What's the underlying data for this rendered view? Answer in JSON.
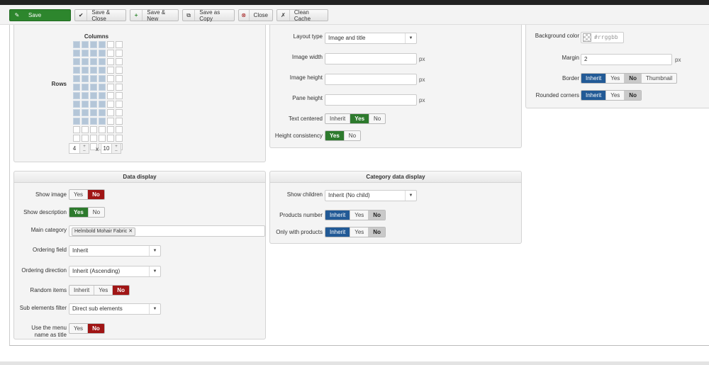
{
  "toolbar": {
    "save": "Save",
    "save_close": "Save & Close",
    "save_new": "Save & New",
    "save_copy": "Save as Copy",
    "close": "Close",
    "clean_cache": "Clean Cache"
  },
  "layout_grid": {
    "columns_label": "Columns",
    "rows_label": "Rows",
    "columns_value": "4",
    "times": "x",
    "rows_value": "10"
  },
  "layout_settings": {
    "layout_type_label": "Layout type",
    "layout_type_value": "Image and title",
    "image_width_label": "Image width",
    "image_width_value": "",
    "image_height_label": "Image height",
    "image_height_value": "",
    "pane_height_label": "Pane height",
    "pane_height_value": "",
    "px": "px",
    "text_centered_label": "Text centered",
    "text_centered_options": [
      "Inherit",
      "Yes",
      "No"
    ],
    "height_consistency_label": "Height consistency",
    "height_consistency_options": [
      "Yes",
      "No"
    ]
  },
  "style_settings": {
    "background_color_label": "Background color",
    "background_color_placeholder": "#rrggbb",
    "margin_label": "Margin",
    "margin_value": "2",
    "px": "px",
    "border_label": "Border",
    "border_options": [
      "Inherit",
      "Yes",
      "No",
      "Thumbnail"
    ],
    "rounded_corners_label": "Rounded corners",
    "rounded_corners_options": [
      "Inherit",
      "Yes",
      "No"
    ]
  },
  "data_display": {
    "title": "Data display",
    "show_image_label": "Show image",
    "show_image_options": [
      "Yes",
      "No"
    ],
    "show_description_label": "Show description",
    "show_description_options": [
      "Yes",
      "No"
    ],
    "main_category_label": "Main category",
    "main_category_tag": "Helmbold Mohair Fabric",
    "ordering_field_label": "Ordering field",
    "ordering_field_value": "Inherit",
    "ordering_direction_label": "Ordering direction",
    "ordering_direction_value": "Inherit (Ascending)",
    "random_items_label": "Random items",
    "random_items_options": [
      "Inherit",
      "Yes",
      "No"
    ],
    "sub_elements_filter_label": "Sub elements filter",
    "sub_elements_filter_value": "Direct sub elements",
    "use_menu_name_label_1": "Use the menu",
    "use_menu_name_label_2": "name as title",
    "use_menu_name_options": [
      "Yes",
      "No"
    ]
  },
  "category_data_display": {
    "title": "Category data display",
    "show_children_label": "Show children",
    "show_children_value": "Inherit (No child)",
    "products_number_label": "Products number",
    "products_number_options": [
      "Inherit",
      "Yes",
      "No"
    ],
    "only_with_products_label": "Only with products",
    "only_with_products_options": [
      "Inherit",
      "Yes",
      "No"
    ]
  },
  "icons": {
    "save": "save-icon",
    "save_close": "check-icon",
    "save_new": "plus-icon",
    "save_copy": "copy-icon",
    "close": "close-icon",
    "clean_cache": "broom-icon"
  },
  "colors": {
    "primary_green": "#2d862d",
    "active_blue": "#225a96",
    "active_red": "#a01515",
    "grid_fill": "#b4c6d8"
  }
}
